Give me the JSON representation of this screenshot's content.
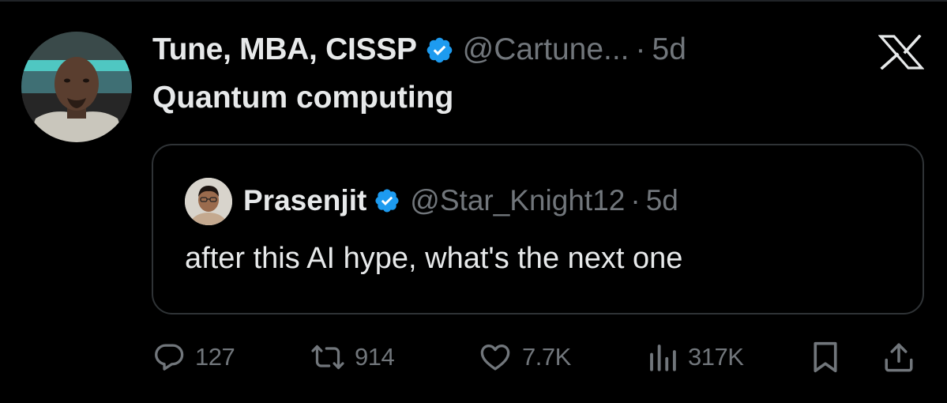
{
  "tweet": {
    "author": {
      "display_name": "Tune, MBA, CISSP",
      "handle": "@Cartune...",
      "verified": true
    },
    "time_ago": "5d",
    "separator": "·",
    "text": "Quantum computing"
  },
  "quoted_tweet": {
    "author": {
      "display_name": "Prasenjit",
      "handle": "@Star_Knight12",
      "verified": true
    },
    "time_ago": "5d",
    "separator": "·",
    "text": "after this AI hype, what's the next one"
  },
  "actions": {
    "reply_count": "127",
    "repost_count": "914",
    "like_count": "7.7K",
    "views_count": "317K"
  },
  "icons": {
    "reply": "reply-icon",
    "repost": "repost-icon",
    "like": "heart-icon",
    "views": "views-icon",
    "bookmark": "bookmark-icon",
    "share": "share-icon",
    "verified": "verified-badge-icon",
    "brand": "x-logo-icon"
  },
  "colors": {
    "background": "#000000",
    "primary_text": "#e7e9ea",
    "secondary_text": "#71767b",
    "border": "#2f3336",
    "verified_blue": "#1d9bf0"
  }
}
